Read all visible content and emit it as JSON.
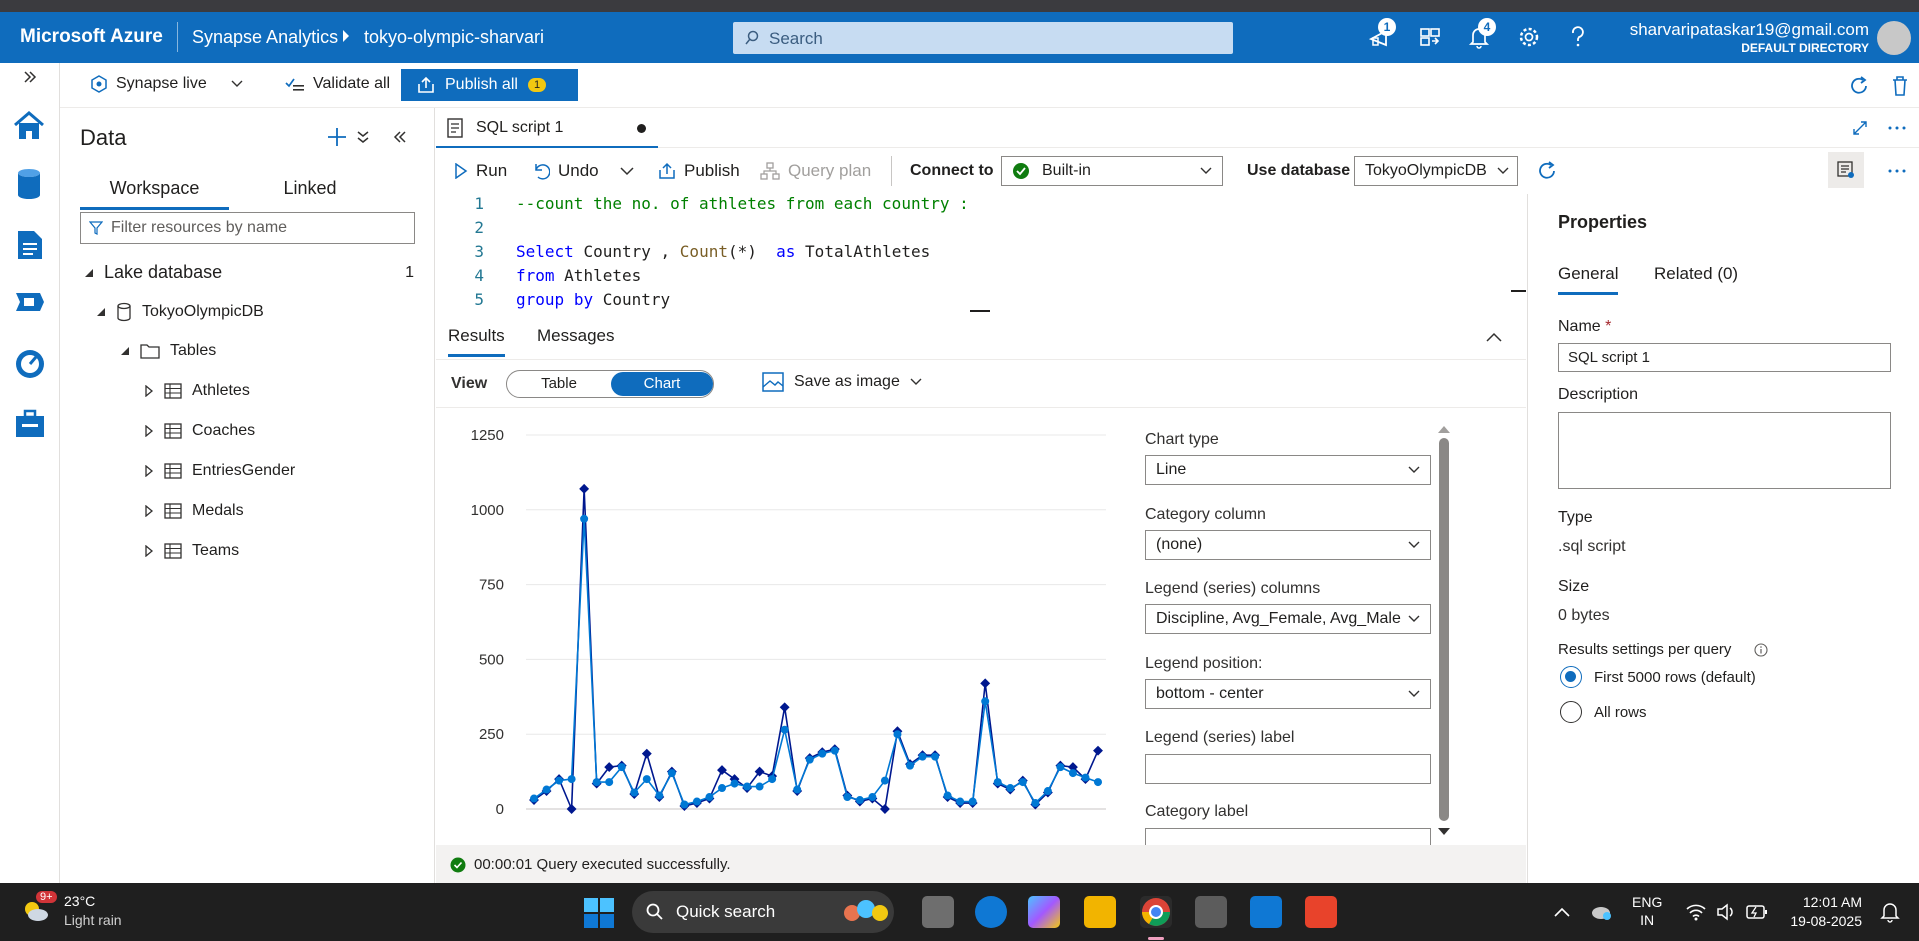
{
  "header": {
    "brand": "Microsoft Azure",
    "service": "Synapse Analytics",
    "workspace": "tokyo-olympic-sharvari",
    "search_placeholder": "Search",
    "notif_badge_1": "1",
    "notif_badge_2": "4",
    "user_email": "sharvaripataskar19@gmail.com",
    "user_directory": "DEFAULT DIRECTORY"
  },
  "commandbar": {
    "synapse_live": "Synapse live",
    "validate_all": "Validate all",
    "publish_all": "Publish all",
    "publish_count": "1"
  },
  "data_panel": {
    "title": "Data",
    "tabs": [
      "Workspace",
      "Linked"
    ],
    "filter_placeholder": "Filter resources by name",
    "lake_database_label": "Lake database",
    "lake_database_count": "1",
    "database": "TokyoOlympicDB",
    "tables_label": "Tables",
    "tables": [
      "Athletes",
      "Coaches",
      "EntriesGender",
      "Medals",
      "Teams"
    ]
  },
  "editor": {
    "tab_title": "SQL script 1",
    "toolbar": {
      "run": "Run",
      "undo": "Undo",
      "publish": "Publish",
      "query_plan": "Query plan",
      "connect_to_label": "Connect to",
      "connect_to_value": "Built-in",
      "use_database_label": "Use database",
      "use_database_value": "TokyoOlympicDB"
    },
    "code_lines": [
      {
        "n": "1",
        "text": "--count the no. of athletes from each country :"
      },
      {
        "n": "2",
        "text": ""
      },
      {
        "n": "3",
        "text": "Select Country , Count(*)  as TotalAthletes"
      },
      {
        "n": "4",
        "text": "from Athletes"
      },
      {
        "n": "5",
        "text": "group by Country"
      }
    ]
  },
  "results": {
    "tabs": [
      "Results",
      "Messages"
    ],
    "view_label": "View",
    "view_table": "Table",
    "view_chart": "Chart",
    "save_as_image": "Save as image",
    "status": "00:00:01 Query executed successfully."
  },
  "chart_settings": {
    "chart_type_label": "Chart type",
    "chart_type_value": "Line",
    "category_column_label": "Category column",
    "category_column_value": "(none)",
    "legend_series_label": "Legend (series) columns",
    "legend_series_value": "Discipline, Avg_Female, Avg_Male",
    "legend_position_label": "Legend position:",
    "legend_position_value": "bottom - center",
    "legend_series_label_label": "Legend (series) label",
    "category_label_label": "Category label"
  },
  "chart_data": {
    "type": "line",
    "ylim": [
      0,
      1250
    ],
    "yticks": [
      0,
      250,
      500,
      750,
      1000,
      1250
    ],
    "series": [
      {
        "color": "#00188f",
        "values": [
          30,
          60,
          100,
          0,
          1070,
          85,
          140,
          145,
          50,
          185,
          40,
          125,
          10,
          20,
          35,
          130,
          100,
          70,
          125,
          110,
          340,
          60,
          170,
          190,
          200,
          45,
          25,
          35,
          0,
          260,
          150,
          180,
          180,
          40,
          20,
          20,
          420,
          85,
          65,
          95,
          15,
          55,
          145,
          140,
          100,
          195
        ]
      },
      {
        "color": "#0078d4",
        "values": [
          35,
          65,
          95,
          100,
          970,
          90,
          90,
          140,
          55,
          100,
          45,
          120,
          15,
          25,
          40,
          70,
          85,
          75,
          75,
          100,
          265,
          65,
          165,
          185,
          195,
          40,
          30,
          40,
          95,
          250,
          145,
          175,
          175,
          45,
          25,
          25,
          360,
          90,
          70,
          90,
          20,
          60,
          140,
          120,
          105,
          90
        ]
      }
    ]
  },
  "properties": {
    "title": "Properties",
    "tabs": [
      "General",
      "Related (0)"
    ],
    "name_label": "Name",
    "name_required": "*",
    "name_value": "SQL script 1",
    "description_label": "Description",
    "type_label": "Type",
    "type_value": ".sql script",
    "size_label": "Size",
    "size_value": "0 bytes",
    "results_settings_label": "Results settings per query",
    "option_first": "First 5000 rows (default)",
    "option_all": "All rows"
  },
  "taskbar": {
    "weather_badge": "9+",
    "temperature": "23°C",
    "weather": "Light rain",
    "search_label": "Quick search",
    "lang1": "ENG",
    "lang2": "IN",
    "time": "12:01 AM",
    "date": "19-08-2025"
  }
}
